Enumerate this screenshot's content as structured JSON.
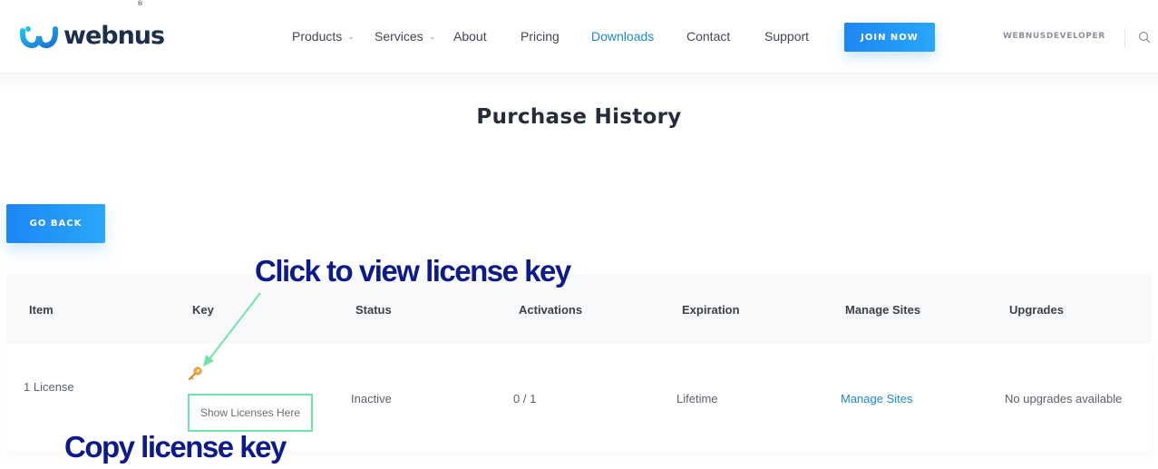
{
  "header": {
    "logo_text": "webnus",
    "logo_reg": "®",
    "nav": [
      {
        "label": "Products",
        "has_dropdown": true
      },
      {
        "label": "Services",
        "has_dropdown": true
      },
      {
        "label": "About"
      },
      {
        "label": "Pricing"
      },
      {
        "label": "Downloads",
        "active": true
      },
      {
        "label": "Contact"
      },
      {
        "label": "Support"
      }
    ],
    "join_label": "JOIN NOW",
    "username": "WEBNUSDEVELOPER",
    "chevron": "⌄"
  },
  "page": {
    "title": "Purchase History",
    "go_back_label": "GO BACK"
  },
  "table": {
    "columns": [
      "Item",
      "Key",
      "Status",
      "Activations",
      "Expiration",
      "Manage Sites",
      "Upgrades"
    ],
    "row": {
      "item": "1 License",
      "key_button": "Show Licenses Here",
      "status": "Inactive",
      "activations": "0 / 1",
      "expiration": "Lifetime",
      "manage_sites": "Manage Sites",
      "upgrades": "No upgrades available"
    }
  },
  "annotations": {
    "view_key": "Click to view license key",
    "copy_key": "Copy license key"
  },
  "colors": {
    "accent": "#1c88d6",
    "button": "#1d86f5",
    "annotation": "#0d1a8c",
    "highlight_box": "#6fe3a8"
  }
}
